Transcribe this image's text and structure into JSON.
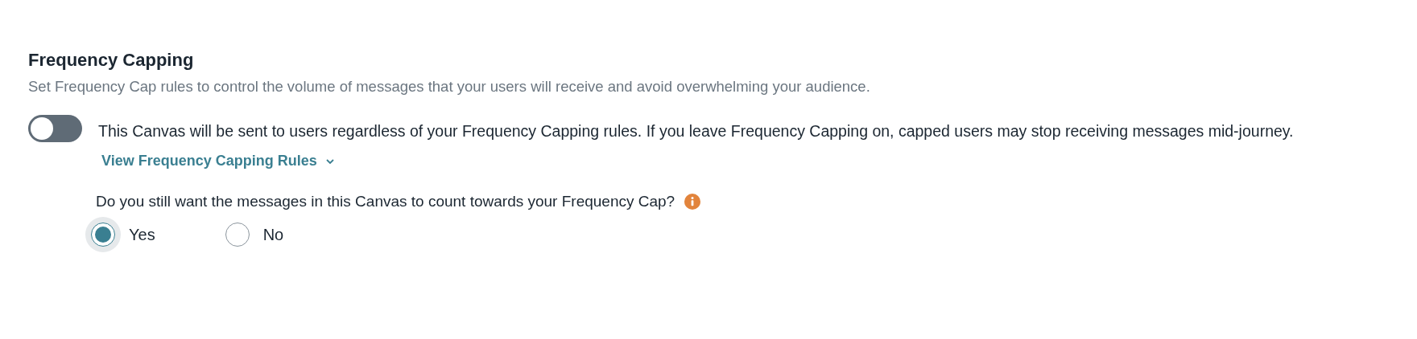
{
  "section": {
    "title": "Frequency Capping",
    "description": "Set Frequency Cap rules to control the volume of messages that your users will receive and avoid overwhelming your audience."
  },
  "toggle": {
    "on": false
  },
  "notice": {
    "text": "This Canvas will be sent to users regardless of your Frequency Capping rules. If you leave Frequency Capping on, capped users may stop receiving messages mid-journey.",
    "link": "View Frequency Capping Rules",
    "link_expanded": false
  },
  "question": {
    "text": "Do you still want the messages in this Canvas to count towards your Frequency Cap?"
  },
  "options": [
    {
      "label": "Yes",
      "selected": true
    },
    {
      "label": "No",
      "selected": false
    }
  ]
}
